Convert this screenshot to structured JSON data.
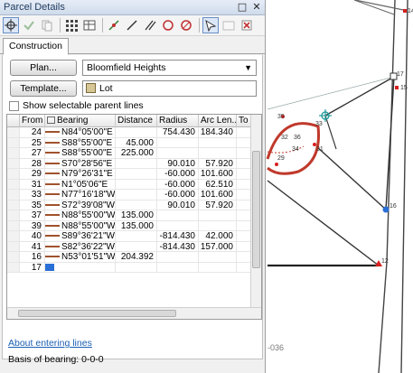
{
  "panel": {
    "title": "Parcel Details",
    "window_buttons": [
      "□",
      "✕"
    ],
    "tab_label": "Construction",
    "plan_button": "Plan...",
    "plan_value": "Bloomfield Heights",
    "template_button": "Template...",
    "template_value": "Lot",
    "show_parent_lines": "Show selectable parent lines",
    "about_link": "About entering lines",
    "basis_of_bearing": "Basis of bearing: 0-0-0"
  },
  "grid": {
    "columns": [
      "From",
      "Bearing",
      "Distance",
      "Radius",
      "Arc Len...",
      "To"
    ],
    "rows": [
      {
        "from": "24",
        "bearing": "N84°05'00\"E",
        "distance": "",
        "radius": "754.430",
        "arc": "184.340"
      },
      {
        "from": "25",
        "bearing": "S88°55'00\"E",
        "distance": "45.000",
        "radius": "",
        "arc": ""
      },
      {
        "from": "27",
        "bearing": "S88°55'00\"E",
        "distance": "225.000",
        "radius": "",
        "arc": ""
      },
      {
        "from": "28",
        "bearing": "S70°28'56\"E",
        "distance": "",
        "radius": "90.010",
        "arc": "57.920"
      },
      {
        "from": "29",
        "bearing": "N79°26'31\"E",
        "distance": "",
        "radius": "-60.000",
        "arc": "101.600"
      },
      {
        "from": "31",
        "bearing": "N1°05'06\"E",
        "distance": "",
        "radius": "-60.000",
        "arc": "62.510"
      },
      {
        "from": "33",
        "bearing": "N77°16'18\"W",
        "distance": "",
        "radius": "-60.000",
        "arc": "101.600"
      },
      {
        "from": "35",
        "bearing": "S72°39'08\"W",
        "distance": "",
        "radius": "90.010",
        "arc": "57.920"
      },
      {
        "from": "37",
        "bearing": "N88°55'00\"W",
        "distance": "135.000",
        "radius": "",
        "arc": ""
      },
      {
        "from": "39",
        "bearing": "N88°55'00\"W",
        "distance": "135.000",
        "radius": "",
        "arc": ""
      },
      {
        "from": "40",
        "bearing": "S89°36'21\"W",
        "distance": "",
        "radius": "-814.430",
        "arc": "42.000"
      },
      {
        "from": "41",
        "bearing": "S82°36'22\"W",
        "distance": "",
        "radius": "-814.430",
        "arc": "157.000"
      },
      {
        "from": "16",
        "bearing": "N53°01'51\"W",
        "distance": "204.392",
        "radius": "",
        "arc": ""
      },
      {
        "from": "17",
        "bearing": "",
        "distance": "",
        "radius": "",
        "arc": ""
      }
    ]
  },
  "map": {
    "labels": [
      "14",
      "17",
      "15",
      "35",
      "33",
      "32",
      "36",
      "34",
      "31",
      "29",
      "16",
      "12"
    ],
    "partial_text": "-036",
    "colors": {
      "curve": "#c0392b",
      "lines": "#333333",
      "selected_point": "#2a6fd6",
      "control_point": "#d62020",
      "cursor": "#2a9d9d"
    }
  },
  "toolbar": {
    "icons": [
      "crosshair-icon",
      "check-icon",
      "copy-icon",
      "grid-dots-icon",
      "table-icon",
      "merge-icon",
      "line-icon",
      "parallel-icon",
      "circle-icon",
      "close-loop-icon",
      "select-lines-icon",
      "delete-icon"
    ]
  },
  "colors": {
    "accent": "#1a5fb4",
    "title_text": "#1e3a5f"
  }
}
